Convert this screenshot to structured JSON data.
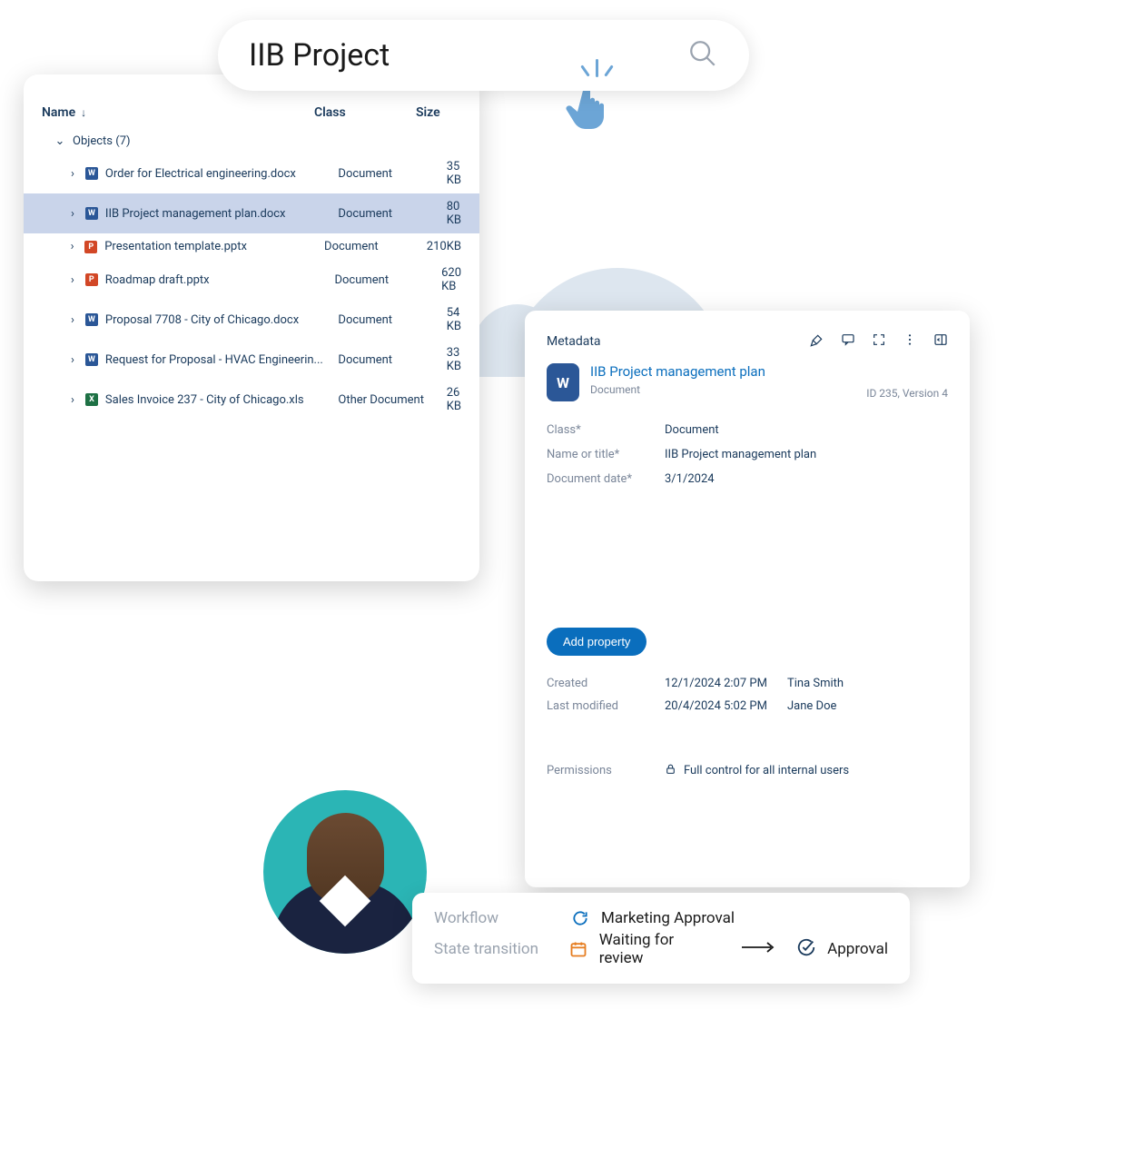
{
  "search": {
    "query": "IIB Project"
  },
  "files": {
    "columns": {
      "name": "Name",
      "class": "Class",
      "size": "Size"
    },
    "group_label": "Objects (7)",
    "rows": [
      {
        "icon": "word",
        "name": "Order for Electrical engineering.docx",
        "class": "Document",
        "size": "35 KB"
      },
      {
        "icon": "word",
        "name": "IIB Project management plan.docx",
        "class": "Document",
        "size": "80 KB",
        "selected": true
      },
      {
        "icon": "ppt",
        "name": "Presentation template.pptx",
        "class": "Document",
        "size": "210KB"
      },
      {
        "icon": "ppt",
        "name": "Roadmap draft.pptx",
        "class": "Document",
        "size": "620 KB"
      },
      {
        "icon": "word",
        "name": "Proposal 7708 - City of Chicago.docx",
        "class": "Document",
        "size": "54 KB"
      },
      {
        "icon": "word",
        "name": "Request for Proposal - HVAC Engineerin...",
        "class": "Document",
        "size": "33 KB"
      },
      {
        "icon": "xls",
        "name": "Sales Invoice 237 - City of Chicago.xls",
        "class": "Other Document",
        "size": "26 KB"
      }
    ]
  },
  "metadata": {
    "panel_title": "Metadata",
    "doc_title": "IIB Project management plan",
    "doc_type": "Document",
    "doc_id": "ID 235, Version 4",
    "fields": {
      "class_label": "Class*",
      "class_value": "Document",
      "name_label": "Name or title*",
      "name_value": "IIB Project management plan",
      "date_label": "Document date*",
      "date_value": "3/1/2024"
    },
    "add_property_label": "Add property",
    "audit": {
      "created_label": "Created",
      "created_date": "12/1/2024 2:07 PM",
      "created_by": "Tina Smith",
      "modified_label": "Last modified",
      "modified_date": "20/4/2024 5:02 PM",
      "modified_by": "Jane Doe"
    },
    "permissions_label": "Permissions",
    "permissions_value": "Full control for all internal users"
  },
  "workflow": {
    "workflow_label": "Workflow",
    "workflow_value": "Marketing Approval",
    "state_label": "State transition",
    "state_from": "Waiting for review",
    "state_to": "Approval"
  }
}
